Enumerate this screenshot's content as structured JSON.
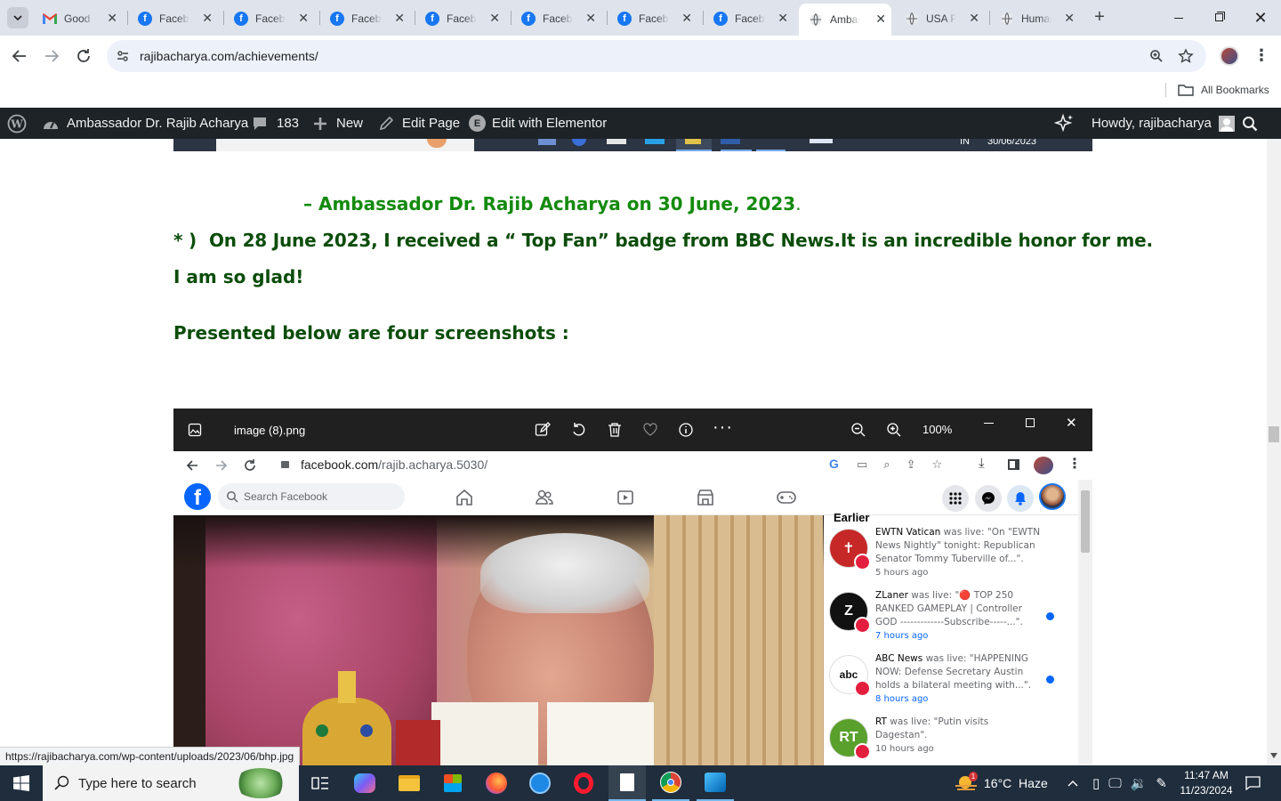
{
  "tabs": [
    {
      "title": "Good",
      "favicon": "gmail-icon"
    },
    {
      "title": "Facebo",
      "favicon": "facebook-icon"
    },
    {
      "title": "Facebo",
      "favicon": "facebook-icon"
    },
    {
      "title": "Facebo",
      "favicon": "facebook-icon"
    },
    {
      "title": "Facebo",
      "favicon": "facebook-icon"
    },
    {
      "title": "Facebo",
      "favicon": "facebook-icon"
    },
    {
      "title": "Facebo",
      "favicon": "facebook-icon"
    },
    {
      "title": "Facebo",
      "favicon": "facebook-icon"
    },
    {
      "title": "Ambas",
      "favicon": "globe-icon",
      "active": true
    },
    {
      "title": "USA P",
      "favicon": "globe-icon"
    },
    {
      "title": "Human",
      "favicon": "globe-icon"
    }
  ],
  "address": {
    "url": "rajibacharya.com/achievements/"
  },
  "bookmarks": {
    "all_label": "All Bookmarks"
  },
  "wpbar": {
    "site": "Ambassador Dr. Rajib Acharya",
    "comments": "183",
    "new": "New",
    "edit_page": "Edit Page",
    "elementor": "Edit with Elementor",
    "howdy": "Howdy, rajibacharya"
  },
  "top_strip": {
    "lang": "IN",
    "date": "30/06/2023"
  },
  "content": {
    "signature": "– Ambassador Dr. Rajib Acharya on 30 June, 2023",
    "signature_dot": ".",
    "para_marker": "* )",
    "para_line1": "On 28 June 2023, I received a “ Top Fan” badge from BBC News.It is an incredible honor for me.",
    "para_line2": "I am so glad!",
    "subhead": "Presented below are four screenshots :"
  },
  "viewer": {
    "filename": "image (8).png",
    "zoom": "100%"
  },
  "inner_browser": {
    "url_host": "facebook.com",
    "url_path": "/rajib.acharya.5030/"
  },
  "facebook": {
    "search_placeholder": "Search Facebook",
    "earlier": "Earlier",
    "notifications": [
      {
        "name": "EWTN Vatican",
        "text": " was live: \"On \"EWTN News Nightly\" tonight: Republican Senator Tommy Tuberville of...\".",
        "time": "5 hours ago",
        "unread": false,
        "avatar_color": "#c62828",
        "avatar_text": "✝"
      },
      {
        "name": "ZLaner",
        "text": " was live: \"🔴 TOP 250 RANKED GAMEPLAY | Controller GOD -------------Subscribe-----...\".",
        "time": "7 hours ago",
        "unread": true,
        "avatar_color": "#111111",
        "avatar_text": "Z"
      },
      {
        "name": "ABC News",
        "text": " was live: \"HAPPENING NOW: Defense Secretary Austin holds a bilateral meeting with...\".",
        "time": "8 hours ago",
        "unread": true,
        "avatar_color": "#ffffff",
        "avatar_text": "abc"
      },
      {
        "name": "RT",
        "text": " was live: \"Putin visits Dagestan\".",
        "time": "10 hours ago",
        "unread": false,
        "avatar_color": "#5aa02c",
        "avatar_text": "RT"
      }
    ]
  },
  "status_url": "https://rajibacharya.com/wp-content/uploads/2023/06/bhp.jpg",
  "taskbar": {
    "search_placeholder": "Type here to search",
    "weather": "16°C  Haze",
    "weather_badge": "1",
    "time": "11:47 AM",
    "date": "11/23/2024"
  },
  "colors": {
    "wp_bar": "#1d2327",
    "heading_green": "#138a0e",
    "dark_green": "#0b4d0a",
    "facebook_blue": "#0866ff"
  }
}
